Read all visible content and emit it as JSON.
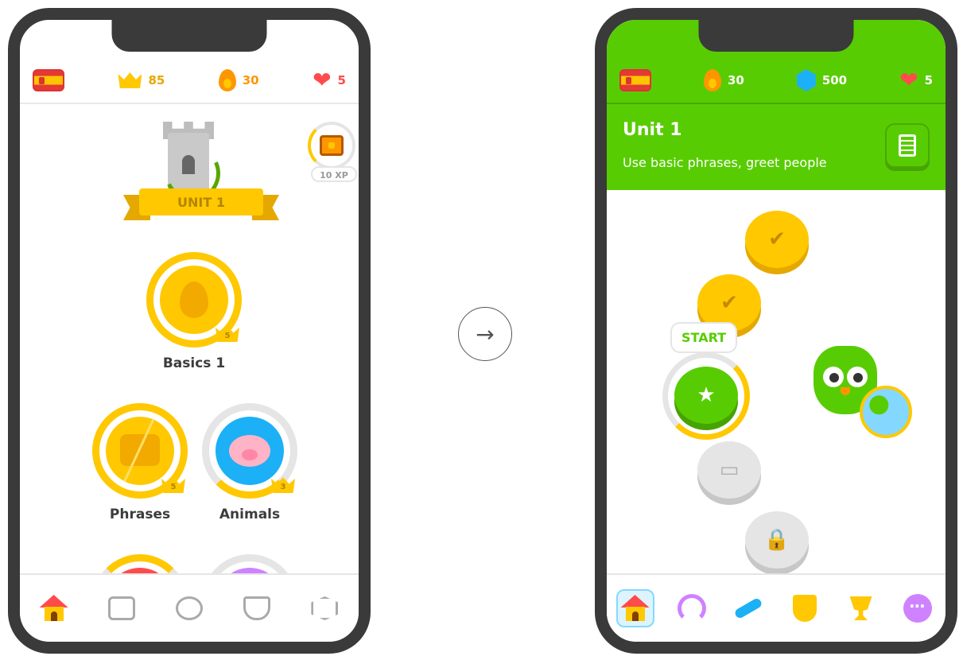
{
  "left_phone": {
    "stats": {
      "crowns": "85",
      "streak": "30",
      "hearts": "5"
    },
    "unit_banner": "UNIT 1",
    "chest_xp": "10 XP",
    "skills": [
      {
        "label": "Basics 1",
        "level": "5"
      },
      {
        "label": "Phrases",
        "level": "5"
      },
      {
        "label": "Animals",
        "level": "3"
      }
    ],
    "tabs": [
      "home-icon",
      "book-icon",
      "characters-icon",
      "shield-icon",
      "hexagon-icon"
    ]
  },
  "right_phone": {
    "stats": {
      "streak": "30",
      "gems": "500",
      "hearts": "5"
    },
    "unit_title": "Unit 1",
    "unit_subtitle": "Use basic phrases, greet people",
    "start_label": "START",
    "tabs": [
      "home-icon",
      "headphones-icon",
      "dumbbell-icon",
      "league-shield-icon",
      "trophy-icon",
      "more-icon"
    ]
  },
  "colors": {
    "green": "#58cc02",
    "gold": "#ffc800",
    "red": "#ff4b4b",
    "orange": "#ff9600",
    "blue": "#1cb0f6"
  }
}
